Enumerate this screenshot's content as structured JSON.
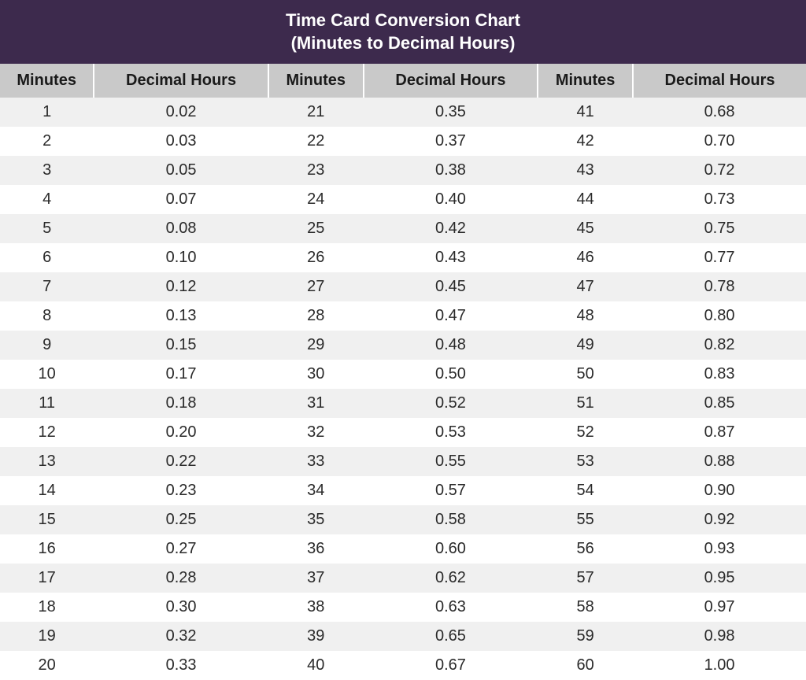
{
  "title_line1": "Time Card Conversion Chart",
  "title_line2": "(Minutes to Decimal Hours)",
  "headers": [
    "Minutes",
    "Decimal Hours",
    "Minutes",
    "Decimal Hours",
    "Minutes",
    "Decimal Hours"
  ],
  "chart_data": {
    "type": "table",
    "title": "Time Card Conversion Chart (Minutes to Decimal Hours)",
    "columns": [
      "Minutes",
      "Decimal Hours",
      "Minutes",
      "Decimal Hours",
      "Minutes",
      "Decimal Hours"
    ],
    "rows": [
      [
        "1",
        "0.02",
        "21",
        "0.35",
        "41",
        "0.68"
      ],
      [
        "2",
        "0.03",
        "22",
        "0.37",
        "42",
        "0.70"
      ],
      [
        "3",
        "0.05",
        "23",
        "0.38",
        "43",
        "0.72"
      ],
      [
        "4",
        "0.07",
        "24",
        "0.40",
        "44",
        "0.73"
      ],
      [
        "5",
        "0.08",
        "25",
        "0.42",
        "45",
        "0.75"
      ],
      [
        "6",
        "0.10",
        "26",
        "0.43",
        "46",
        "0.77"
      ],
      [
        "7",
        "0.12",
        "27",
        "0.45",
        "47",
        "0.78"
      ],
      [
        "8",
        "0.13",
        "28",
        "0.47",
        "48",
        "0.80"
      ],
      [
        "9",
        "0.15",
        "29",
        "0.48",
        "49",
        "0.82"
      ],
      [
        "10",
        "0.17",
        "30",
        "0.50",
        "50",
        "0.83"
      ],
      [
        "11",
        "0.18",
        "31",
        "0.52",
        "51",
        "0.85"
      ],
      [
        "12",
        "0.20",
        "32",
        "0.53",
        "52",
        "0.87"
      ],
      [
        "13",
        "0.22",
        "33",
        "0.55",
        "53",
        "0.88"
      ],
      [
        "14",
        "0.23",
        "34",
        "0.57",
        "54",
        "0.90"
      ],
      [
        "15",
        "0.25",
        "35",
        "0.58",
        "55",
        "0.92"
      ],
      [
        "16",
        "0.27",
        "36",
        "0.60",
        "56",
        "0.93"
      ],
      [
        "17",
        "0.28",
        "37",
        "0.62",
        "57",
        "0.95"
      ],
      [
        "18",
        "0.30",
        "38",
        "0.63",
        "58",
        "0.97"
      ],
      [
        "19",
        "0.32",
        "39",
        "0.65",
        "59",
        "0.98"
      ],
      [
        "20",
        "0.33",
        "40",
        "0.67",
        "60",
        "1.00"
      ]
    ]
  }
}
